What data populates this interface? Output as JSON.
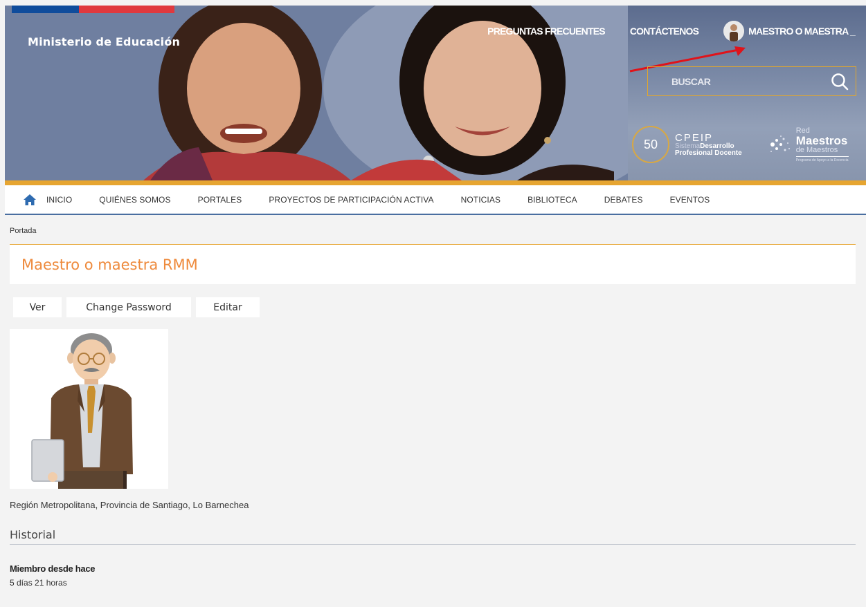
{
  "header": {
    "ministry": "Ministerio de Educación",
    "top_links": {
      "faq": "PREGUNTAS FRECUENTES",
      "contact": "CONTÁCTENOS",
      "user": "MAESTRO O MAESTRA _"
    },
    "search": {
      "placeholder": "BUSCAR"
    },
    "logos": {
      "badge": "50",
      "cpeip_title": "CPEIP",
      "cpeip_sub_light": "Sistema",
      "cpeip_sub_bold": "Desarrollo",
      "cpeip_line3": "Profesional Docente",
      "rmm_line1": "Red",
      "rmm_line2": "Maestros",
      "rmm_line3": "de Maestros",
      "rmm_tagline": "Programa de Apoyo a la Docencia"
    }
  },
  "nav": {
    "items": [
      "INICIO",
      "QUIÉNES SOMOS",
      "PORTALES",
      "PROYECTOS DE PARTICIPACIÓN ACTIVA",
      "NOTICIAS",
      "BIBLIOTECA",
      "DEBATES",
      "EVENTOS"
    ]
  },
  "breadcrumb": "Portada",
  "page_title": "Maestro o maestra RMM",
  "tabs": [
    "Ver",
    "Change Password",
    "Editar"
  ],
  "profile": {
    "region": "Región Metropolitana, Provincia de Santiago, Lo Barnechea",
    "history_title": "Historial",
    "member_label": "Miembro desde hace",
    "member_value": "5 días 21 horas"
  },
  "colors": {
    "accent_orange": "#e6a531",
    "title_orange": "#ee8a3c",
    "nav_blue": "#4a6ea0"
  }
}
